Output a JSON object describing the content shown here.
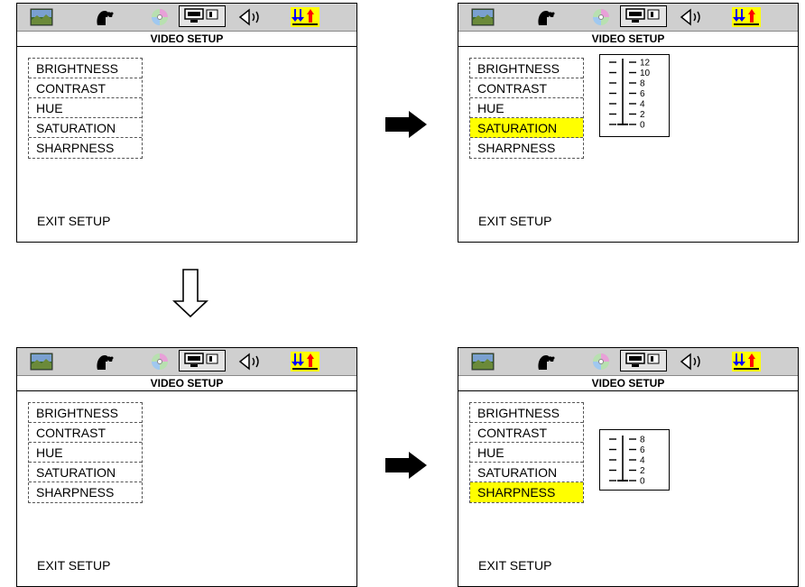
{
  "screens": [
    {
      "title": "VIDEO SETUP",
      "menu": [
        "BRIGHTNESS",
        "CONTRAST",
        "HUE",
        "SATURATION",
        "SHARPNESS"
      ],
      "selected_index": -1,
      "exit_label": "EXIT SETUP"
    },
    {
      "title": "VIDEO SETUP",
      "menu": [
        "BRIGHTNESS",
        "CONTRAST",
        "HUE",
        "SATURATION",
        "SHARPNESS"
      ],
      "selected_index": 3,
      "exit_label": "EXIT SETUP",
      "slider": {
        "ticks": [
          "12",
          "10",
          "8",
          "6",
          "4",
          "2",
          "0"
        ],
        "level": "0"
      }
    },
    {
      "title": "VIDEO SETUP",
      "menu": [
        "BRIGHTNESS",
        "CONTRAST",
        "HUE",
        "SATURATION",
        "SHARPNESS"
      ],
      "selected_index": -1,
      "exit_label": "EXIT SETUP"
    },
    {
      "title": "VIDEO SETUP",
      "menu": [
        "BRIGHTNESS",
        "CONTRAST",
        "HUE",
        "SATURATION",
        "SHARPNESS"
      ],
      "selected_index": 4,
      "exit_label": "EXIT SETUP",
      "slider": {
        "ticks": [
          "8",
          "6",
          "4",
          "2",
          "0"
        ],
        "level": "0"
      }
    }
  ],
  "icons": [
    "picture-icon",
    "person-icon",
    "disc-icon",
    "video-icon",
    "speaker-icon",
    "up-down-arrows-icon"
  ],
  "colors": {
    "highlight": "#ffff00",
    "iconbar": "#cfcfcf",
    "arrow_down_blue": "#0000ff",
    "arrow_up_red": "#ff0000"
  }
}
